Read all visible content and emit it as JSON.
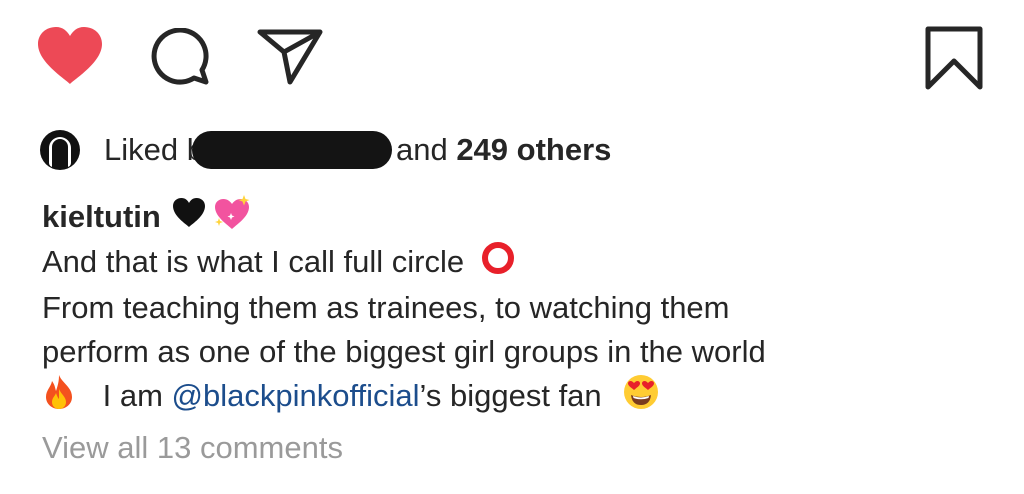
{
  "actions": {
    "like_icon": "heart-filled-icon",
    "comment_icon": "comment-icon",
    "share_icon": "send-icon",
    "save_icon": "bookmark-icon",
    "like_color": "#ed4956"
  },
  "likes": {
    "prefix": "Liked b",
    "suffix": "and ",
    "count_text": "249 others"
  },
  "post": {
    "username": "kieltutin",
    "caption_line1": "And that is what I call full circle",
    "caption_line2": "From teaching them as trainees, to watching them",
    "caption_line3": "perform as one of the biggest girl groups in the world",
    "caption_line4_before": "I am ",
    "mention": "@blackpinkofficial",
    "caption_line4_after": "’s biggest fan"
  },
  "comments": {
    "view_all": "View all 13 comments"
  }
}
